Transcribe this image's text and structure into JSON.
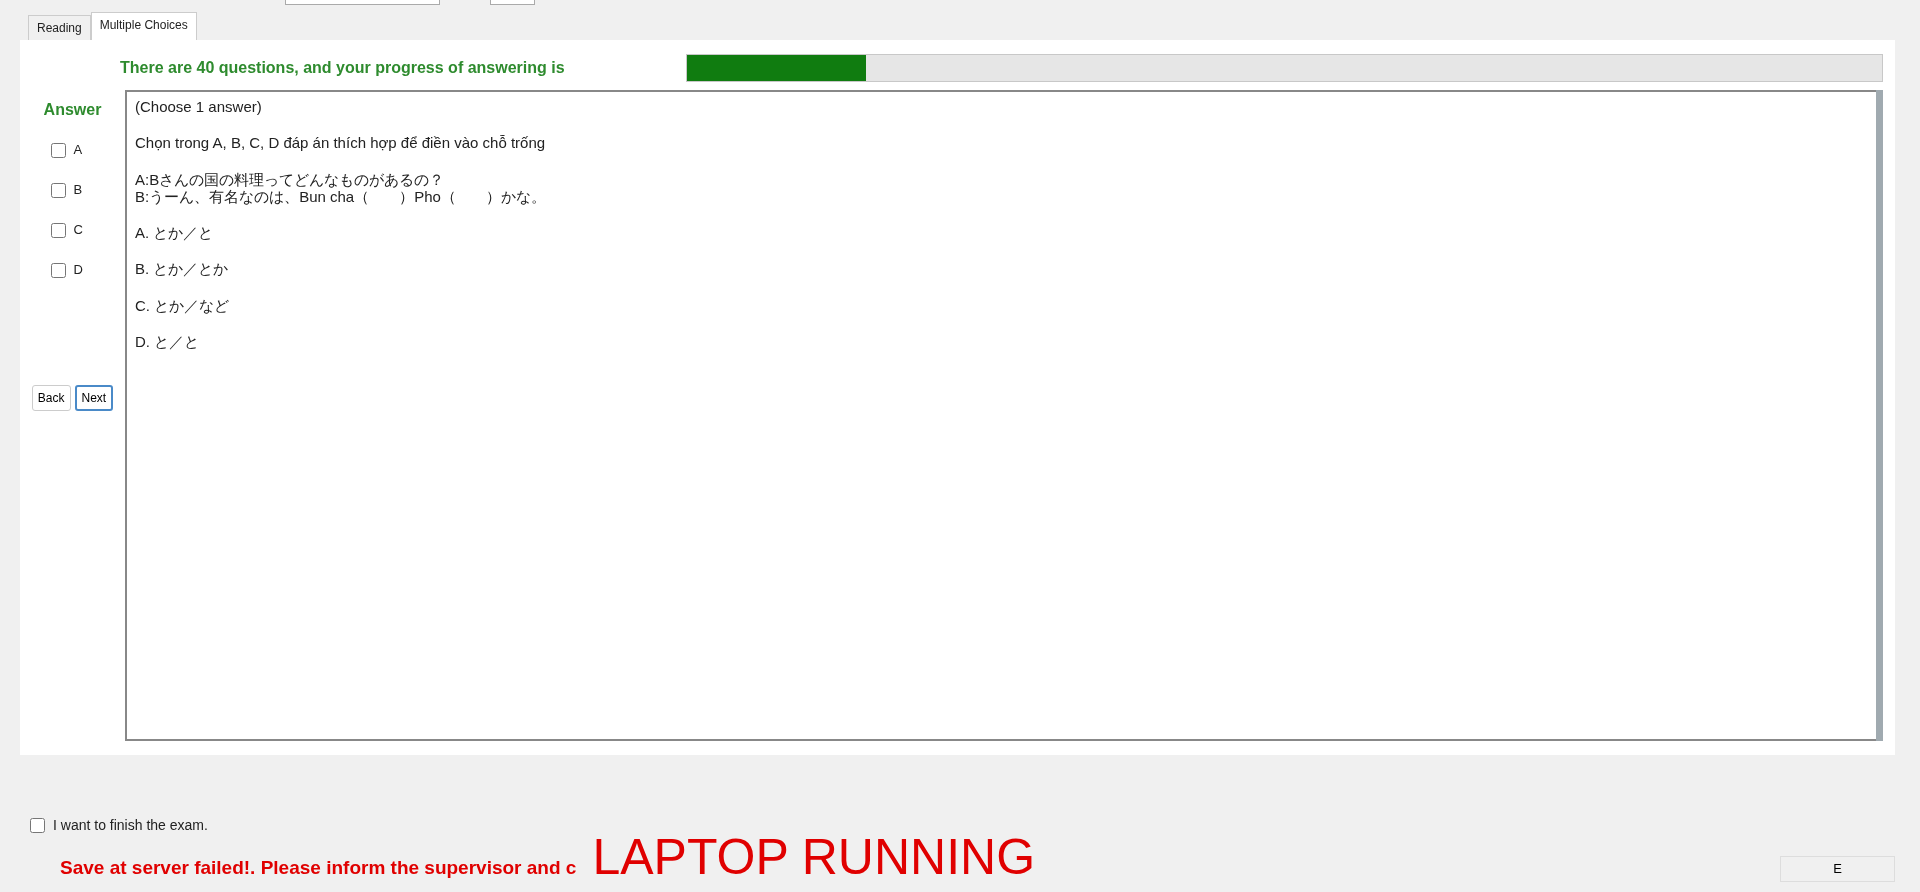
{
  "tabs": [
    {
      "label": "Reading",
      "selected": false
    },
    {
      "label": "Multiple Choices",
      "selected": true
    }
  ],
  "progress": {
    "label": "There are 40 questions, and your progress of answering is",
    "level": 0.15
  },
  "answer_panel": {
    "title": "Answer",
    "options": [
      {
        "label": "A",
        "checked": false
      },
      {
        "label": "B",
        "checked": false
      },
      {
        "label": "C",
        "checked": false
      },
      {
        "label": "D",
        "checked": false
      }
    ],
    "buttons": [
      {
        "label": "Back",
        "selected": false
      },
      {
        "label": "Next",
        "selected": true
      }
    ]
  },
  "question": {
    "lines": [
      "(Choose 1 answer)",
      "Chọn trong A, B, C, D đáp án thích hợp để điền vào chỗ trống",
      "A:Bさんの国の料理ってどんなものがあるの？\nB:うーん、有名なのは、Bun cha（　　）Pho（　　）かな。",
      "A. とか／と",
      "B. とか／とか",
      "C. とか／など",
      "D. と／と"
    ]
  },
  "finish": {
    "label": "I want to finish the exam.",
    "checked": false
  },
  "error_message": "Save at server failed!. Please inform the supervisor and c",
  "banner": "LAPTOP RUNNING",
  "bottom_button": "E"
}
